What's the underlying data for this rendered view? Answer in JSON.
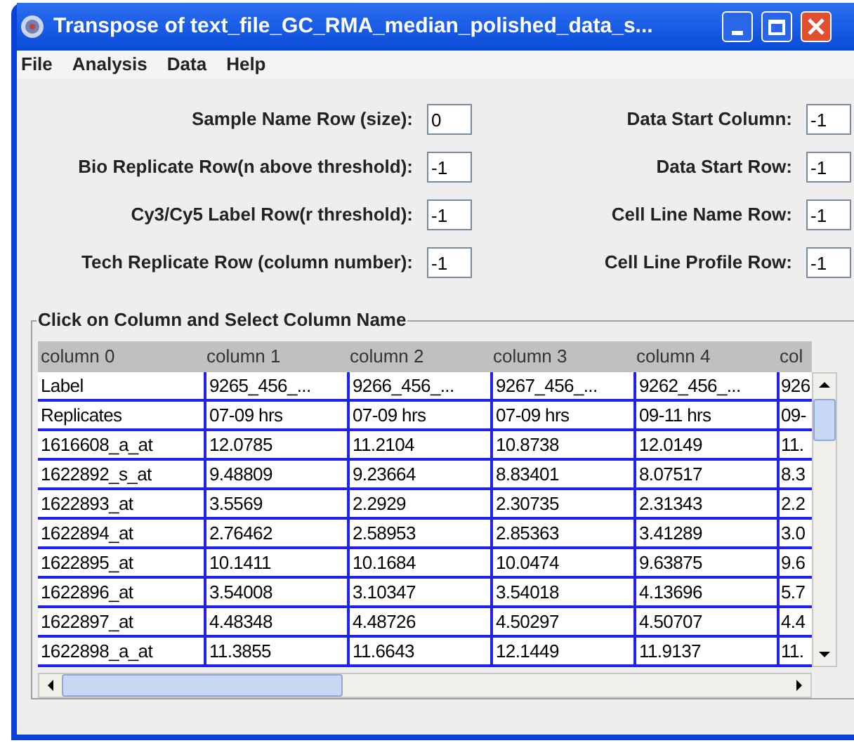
{
  "window": {
    "title": "Transpose of text_file_GC_RMA_median_polished_data_s..."
  },
  "menu": [
    "File",
    "Analysis",
    "Data",
    "Help"
  ],
  "fields_left": [
    {
      "label": "Sample Name Row (size):",
      "value": "0"
    },
    {
      "label": "Bio Replicate Row(n above threshold):",
      "value": "-1"
    },
    {
      "label": "Cy3/Cy5 Label Row(r threshold):",
      "value": "-1"
    },
    {
      "label": "Tech Replicate Row (column number):",
      "value": "-1"
    }
  ],
  "fields_right": [
    {
      "label": "Data Start Column:",
      "value": "-1"
    },
    {
      "label": "Data Start Row:",
      "value": "-1"
    },
    {
      "label": "Cell Line Name Row:",
      "value": "-1"
    },
    {
      "label": "Cell Line Profile Row:",
      "value": "-1"
    }
  ],
  "group": {
    "title": "Click on Column and Select Column Name"
  },
  "table": {
    "columns": [
      "column 0",
      "column 1",
      "column 2",
      "column 3",
      "column 4",
      "col"
    ],
    "rows": [
      [
        "Label",
        "9265_456_...",
        "9266_456_...",
        "9267_456_...",
        "9262_456_...",
        "926"
      ],
      [
        "Replicates",
        "07-09 hrs",
        "07-09 hrs",
        "07-09 hrs",
        "09-11 hrs",
        "09-"
      ],
      [
        "1616608_a_at",
        "12.0785",
        "11.2104",
        "10.8738",
        "12.0149",
        "11."
      ],
      [
        "1622892_s_at",
        "9.48809",
        "9.23664",
        "8.83401",
        "8.07517",
        "8.3"
      ],
      [
        "1622893_at",
        "3.5569",
        "2.2929",
        "2.30735",
        "2.31343",
        "2.2"
      ],
      [
        "1622894_at",
        "2.76462",
        "2.58953",
        "2.85363",
        "3.41289",
        "3.0"
      ],
      [
        "1622895_at",
        "10.1411",
        "10.1684",
        "10.0474",
        "9.63875",
        "9.6"
      ],
      [
        "1622896_at",
        "3.54008",
        "3.10347",
        "3.54018",
        "4.13696",
        "5.7"
      ],
      [
        "1622897_at",
        "4.48348",
        "4.48726",
        "4.50297",
        "4.50707",
        "4.4"
      ],
      [
        "1622898_a_at",
        "11.3855",
        "11.6643",
        "12.1449",
        "11.9137",
        "11."
      ]
    ]
  }
}
